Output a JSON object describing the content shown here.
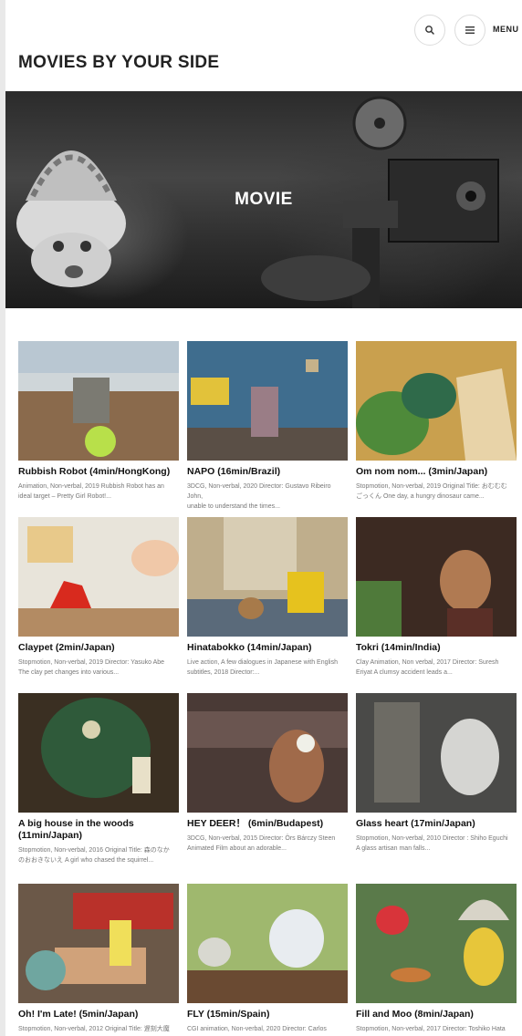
{
  "header": {
    "site_title": "MOVIES BY YOUR SIDE",
    "menu_label": "MENU"
  },
  "hero": {
    "title": "MOVIE"
  },
  "movies": [
    {
      "title": "Rubbish Robot (4min/HongKong)",
      "desc_line1": "Animation, Non-verbal, 2019 Rubbish Robot has an",
      "desc_line2": "ideal target – Pretty Girl Robot!..."
    },
    {
      "title": "NAPO (16min/Brazil)",
      "desc_line1": "3DCG, Non-verbal, 2020 Director: Gustavo Ribeiro John,",
      "desc_line2": "unable to understand the times..."
    },
    {
      "title": "Om nom nom... (3min/Japan)",
      "desc_line1": "Stopmotion, Non-verbal, 2019 Original Title: おむむむ",
      "desc_line2": "ごっくん One day, a hungry dinosaur came..."
    },
    {
      "title": "Claypet (2min/Japan)",
      "desc_line1": "Stopmotion, Non-verbal, 2019 Director: Yasuko Abe",
      "desc_line2": "The clay pet changes into various..."
    },
    {
      "title": "Hinatabokko (14min/Japan)",
      "desc_line1": "Live action, A few dialogues in Japanese with English",
      "desc_line2": "subtitles, 2018 Director:..."
    },
    {
      "title": "Tokri (14min/India)",
      "desc_line1": "Clay Animation, Non verbal, 2017 Director: Suresh",
      "desc_line2": "Eriyat A clumsy accident leads a..."
    },
    {
      "title": "A big house in the woods (11min/Japan)",
      "desc_line1": "Stopmotion, Non-verbal, 2016 Original Title: 森のなか",
      "desc_line2": "のおおきないえ A girl who chased the squirrel..."
    },
    {
      "title": "HEY DEER！ (6min/Budapest)",
      "desc_line1": "3DCG, Non-verbal, 2015 Director: Örs Bárczy Steen",
      "desc_line2": "Animated Film about an adorable..."
    },
    {
      "title": "Glass heart (17min/Japan)",
      "desc_line1": "Stopmotion, Non-verbal, 2010 Director : Shiho Eguchi",
      "desc_line2": "A glass artisan man falls..."
    },
    {
      "title": "Oh! I'm Late! (5min/Japan)",
      "desc_line1": "Stopmotion, Non-verbal, 2012 Original Title: 遅刻大魔",
      "desc_line2": ""
    },
    {
      "title": "FLY (15min/Spain)",
      "desc_line1": "CGI animation, Non-verbal, 2020 Director: Carlos",
      "desc_line2": ""
    },
    {
      "title": "Fill and Moo (8min/Japan)",
      "desc_line1": "Stopmotion, Non-verbal, 2017 Director: Toshiko Hata",
      "desc_line2": ""
    }
  ]
}
